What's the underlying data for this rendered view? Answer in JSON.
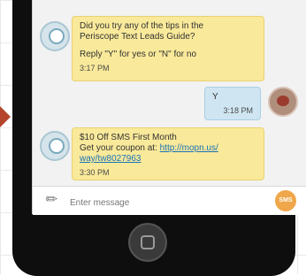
{
  "messages": [
    {
      "direction": "incoming",
      "line1": "Did you try any of the tips in the",
      "line2": "Periscope Text Leads Guide?",
      "line3": "Reply \"Y\" for yes or \"N\" for no",
      "time": "3:17 PM"
    },
    {
      "direction": "outgoing",
      "line1": "Y",
      "time": "3:18 PM"
    },
    {
      "direction": "incoming",
      "line1": "$10 Off SMS First Month",
      "line2_prefix": "Get your coupon at:",
      "link_line1": "http://mopn.us/",
      "link_line2": "way/tw8027963",
      "time": "3:30 PM"
    }
  ],
  "composer": {
    "placeholder": "Enter message",
    "send_label": "SMS"
  },
  "colors": {
    "incoming_bubble": "#f9e99a",
    "outgoing_bubble": "#cfe6f2",
    "send_button": "#f0a64a",
    "accent_arrow": "#b4452c"
  }
}
